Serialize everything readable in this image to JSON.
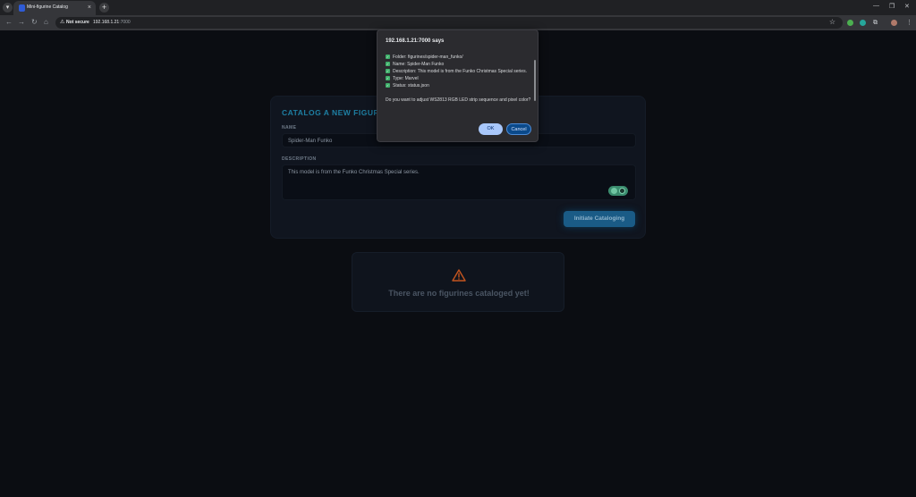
{
  "browser": {
    "tab_title": "Mini-figurine Catalog",
    "tab_close": "×",
    "new_tab": "+",
    "not_secure": "Not secure",
    "url_host": "192.168.1.21",
    "url_port": ":7000"
  },
  "form": {
    "title": "CATALOG A NEW FIGURINE",
    "name_label": "NAME",
    "name_value": "Spider-Man Funko",
    "description_label": "DESCRIPTION",
    "description_value": "This model is from the Funko Christmas Special series.",
    "submit_label": "Initiate Cataloging"
  },
  "empty_state": {
    "message": "There are no figurines cataloged yet!",
    "icon": "warning-triangle-icon",
    "icon_color": "#c4551f"
  },
  "dialog": {
    "title": "192.168.1.21:7000 says",
    "lines": [
      "Folder: figurines/spider-man_funko/",
      "Name: Spider-Man Funko",
      "Description: This model is from the Funko Christmas Special series.",
      "Type: Marvel",
      "Status: status.json"
    ],
    "question": "Do you want to adjust WS2813 RGB LED strip sequence and pixel color?",
    "ok_label": "OK",
    "cancel_label": "Cancel"
  }
}
